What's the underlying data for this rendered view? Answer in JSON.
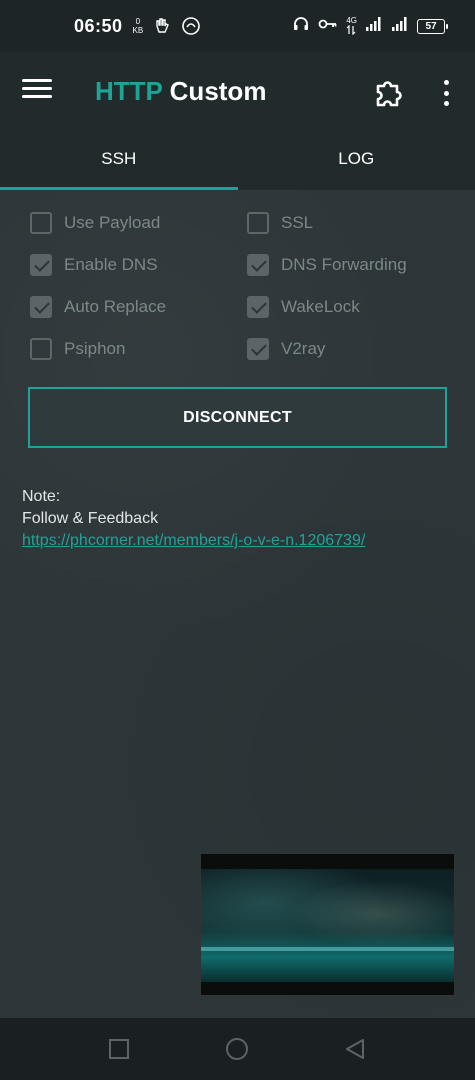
{
  "status_bar": {
    "time": "06:50",
    "data_rate_value": "0",
    "data_rate_unit": "KB",
    "network_type": "4G",
    "battery_level": "57",
    "icons": [
      "hand-icon",
      "circle-logo-icon",
      "headset-icon",
      "key-icon",
      "data-arrows-icon",
      "signal-icon",
      "signal-icon",
      "battery-icon"
    ]
  },
  "app_bar": {
    "title_part1": "HTTP",
    "title_part2": "Custom",
    "icons": [
      "menu-icon",
      "puzzle-icon",
      "more-vert-icon"
    ],
    "accent_color": "#1fa397"
  },
  "tabs": [
    {
      "label": "SSH",
      "active": true
    },
    {
      "label": "LOG",
      "active": false
    }
  ],
  "options": [
    {
      "label": "Use Payload",
      "checked": false
    },
    {
      "label": "SSL",
      "checked": false
    },
    {
      "label": "Enable DNS",
      "checked": true
    },
    {
      "label": "DNS Forwarding",
      "checked": true
    },
    {
      "label": "Auto Replace",
      "checked": true
    },
    {
      "label": "WakeLock",
      "checked": true
    },
    {
      "label": "Psiphon",
      "checked": false
    },
    {
      "label": "V2ray",
      "checked": true
    }
  ],
  "action_button": {
    "label": "DISCONNECT"
  },
  "note": {
    "heading": "Note:",
    "line": "Follow & Feedback",
    "link": "https://phcorner.net/members/j-o-v-e-n.1206739/"
  },
  "nav_bar": {
    "icons": [
      "recents-square-icon",
      "home-circle-icon",
      "back-triangle-icon"
    ]
  }
}
